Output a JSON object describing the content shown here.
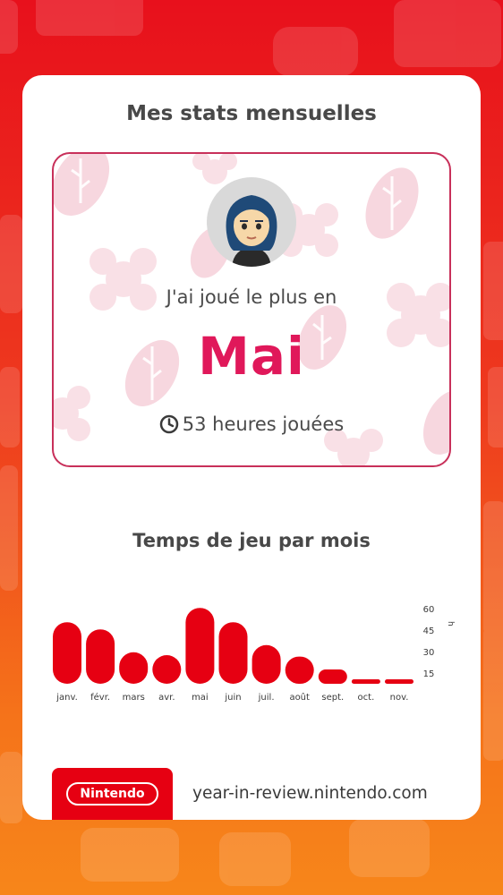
{
  "card": {
    "title": "Mes stats mensuelles"
  },
  "highlight": {
    "subtitle": "J'ai joué le plus en",
    "month": "Mai",
    "hours_text": "53 heures jouées",
    "clock_icon": "clock-icon",
    "avatar_icon": "mii-avatar-icon"
  },
  "chart_section": {
    "title": "Temps de jeu par mois"
  },
  "chart_data": {
    "type": "bar",
    "title": "Temps de jeu par mois",
    "categories": [
      "janv.",
      "févr.",
      "mars",
      "avr.",
      "mai",
      "juin",
      "juil.",
      "août",
      "sept.",
      "oct.",
      "nov."
    ],
    "values": [
      43,
      38,
      22,
      20,
      53,
      43,
      27,
      19,
      10,
      1,
      3
    ],
    "ylabel": "h",
    "yticks": [
      15,
      30,
      45,
      60
    ],
    "ylim": [
      0,
      60
    ],
    "grid": false,
    "bar_color": "#e60012"
  },
  "footer": {
    "logo_text": "Nintendo",
    "url": "year-in-review.nintendo.com"
  },
  "colors": {
    "accent": "#e0185a",
    "brand_red": "#e60012"
  }
}
